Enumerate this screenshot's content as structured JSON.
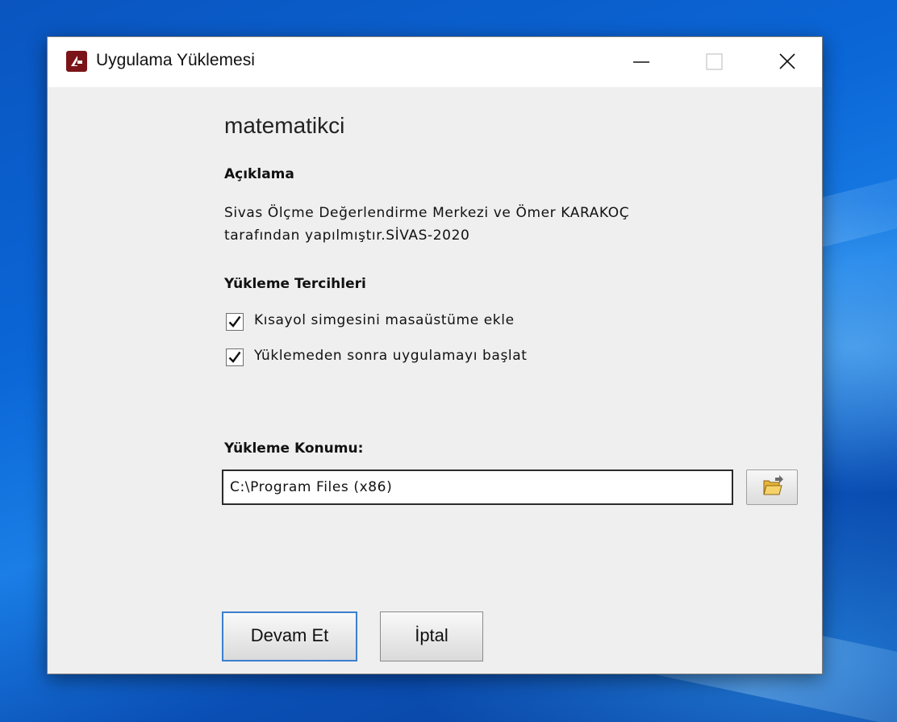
{
  "window": {
    "title": "Uygulama Yüklemesi"
  },
  "app": {
    "name": "matematikci"
  },
  "description": {
    "heading": "Açıklama",
    "lines": [
      "Sivas Ölçme Değerlendirme Merkezi ve Ömer KARAKOÇ",
      "tarafından yapılmıştır.SİVAS-2020"
    ]
  },
  "preferences": {
    "heading": "Yükleme Tercihleri",
    "options": [
      {
        "label": "Kısayol simgesini masaüstüme ekle",
        "checked": true
      },
      {
        "label": "Yüklemeden sonra uygulamayı başlat",
        "checked": true
      }
    ]
  },
  "location": {
    "heading": "Yükleme Konumu:",
    "value": "C:\\Program Files (x86)"
  },
  "buttons": {
    "continue": "Devam Et",
    "cancel": "İptal"
  },
  "colors": {
    "accent": "#3c7fcf",
    "app_icon": "#7a1418",
    "window_bg": "#efefef",
    "desktop": "#0b66d6"
  },
  "icons": {
    "app": "app-logo-icon",
    "minimize": "minimize-icon",
    "maximize": "maximize-icon",
    "close": "close-icon",
    "check": "checkmark-icon",
    "browse": "folder-open-icon"
  }
}
